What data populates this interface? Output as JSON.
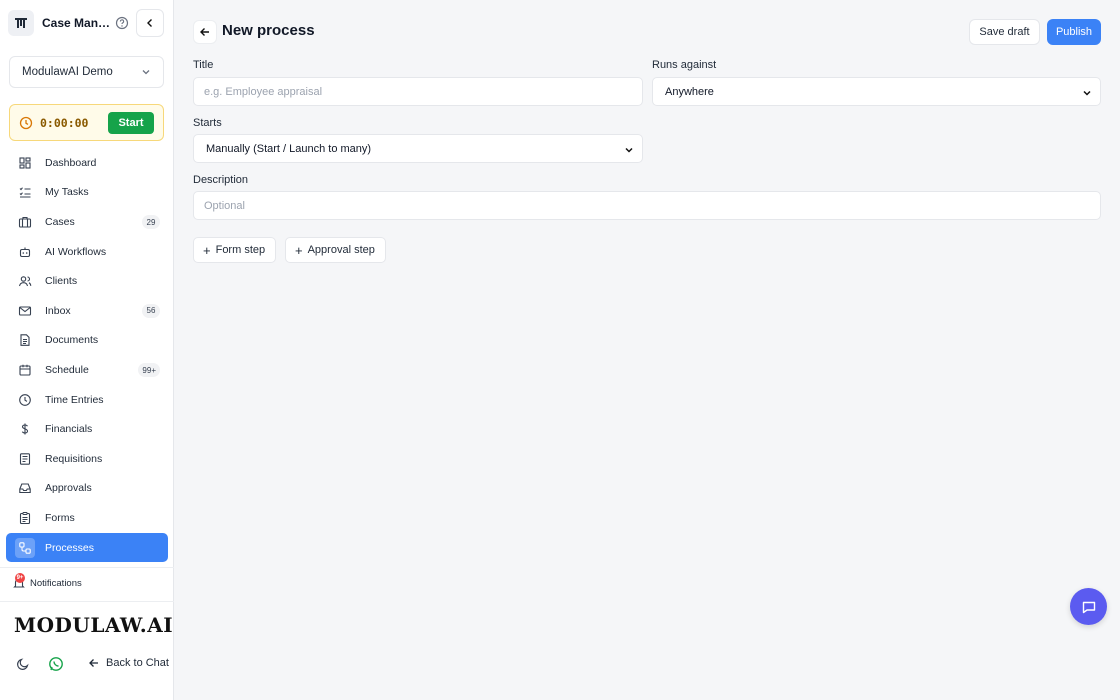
{
  "app": {
    "title": "Case Man…",
    "workspace": "ModulawAI Demo",
    "brand": "MODULAW.AI"
  },
  "timer": {
    "value": "0:00:00",
    "start_label": "Start"
  },
  "nav": [
    {
      "label": "Dashboard",
      "icon": "dashboard-icon",
      "badge": ""
    },
    {
      "label": "My Tasks",
      "icon": "tasks-icon",
      "badge": ""
    },
    {
      "label": "Cases",
      "icon": "briefcase-icon",
      "badge": "29"
    },
    {
      "label": "AI Workflows",
      "icon": "bot-icon",
      "badge": ""
    },
    {
      "label": "Clients",
      "icon": "users-icon",
      "badge": ""
    },
    {
      "label": "Inbox",
      "icon": "mail-icon",
      "badge": "56"
    },
    {
      "label": "Documents",
      "icon": "document-icon",
      "badge": ""
    },
    {
      "label": "Schedule",
      "icon": "calendar-icon",
      "badge": "99+"
    },
    {
      "label": "Time Entries",
      "icon": "clock-icon",
      "badge": ""
    },
    {
      "label": "Financials",
      "icon": "dollar-icon",
      "badge": ""
    },
    {
      "label": "Requisitions",
      "icon": "list-icon",
      "badge": ""
    },
    {
      "label": "Approvals",
      "icon": "inbox-icon",
      "badge": ""
    },
    {
      "label": "Forms",
      "icon": "clipboard-icon",
      "badge": ""
    },
    {
      "label": "Processes",
      "icon": "process-icon",
      "badge": "",
      "active": true
    }
  ],
  "notifications": {
    "label": "Notifications",
    "count": "9+"
  },
  "footer": {
    "back_label": "Back to Chat"
  },
  "page": {
    "title": "New process",
    "save_draft": "Save draft",
    "publish": "Publish",
    "title_label": "Title",
    "title_placeholder": "e.g. Employee appraisal",
    "runs_against_label": "Runs against",
    "runs_against_value": "Anywhere",
    "starts_label": "Starts",
    "starts_value": "Manually (Start / Launch to many)",
    "description_label": "Description",
    "description_placeholder": "Optional",
    "form_step": "Form step",
    "approval_step": "Approval step"
  },
  "colors": {
    "accent": "#3b82f6",
    "start": "#16a34a",
    "chat_fab": "#5b5bf0",
    "timer_bg": "#fffbe9"
  }
}
